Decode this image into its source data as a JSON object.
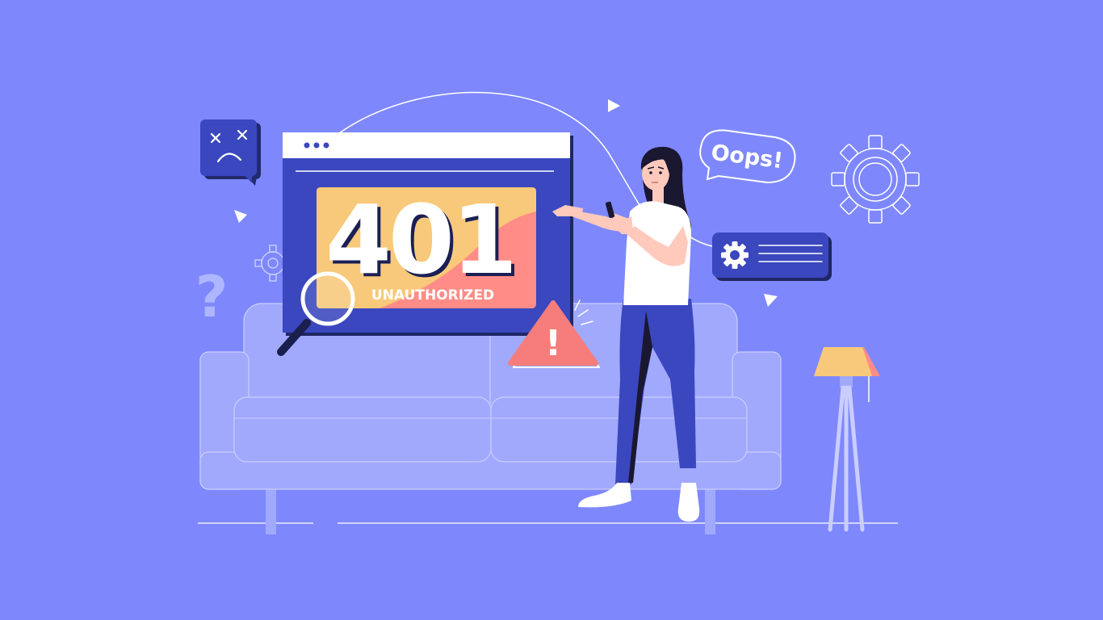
{
  "error": {
    "code": "401",
    "label": "UNAUTHORIZED"
  },
  "bubble": {
    "text": "Oops!"
  },
  "symbols": {
    "question": "?",
    "warning": "!"
  },
  "colors": {
    "background": "#7E88FC",
    "window_blue": "#3A47BE",
    "panel_yellow": "#F8C97A",
    "panel_salmon": "#FF8C86",
    "warning_red": "#F67D7B",
    "sofa": "#A1A9FD"
  }
}
